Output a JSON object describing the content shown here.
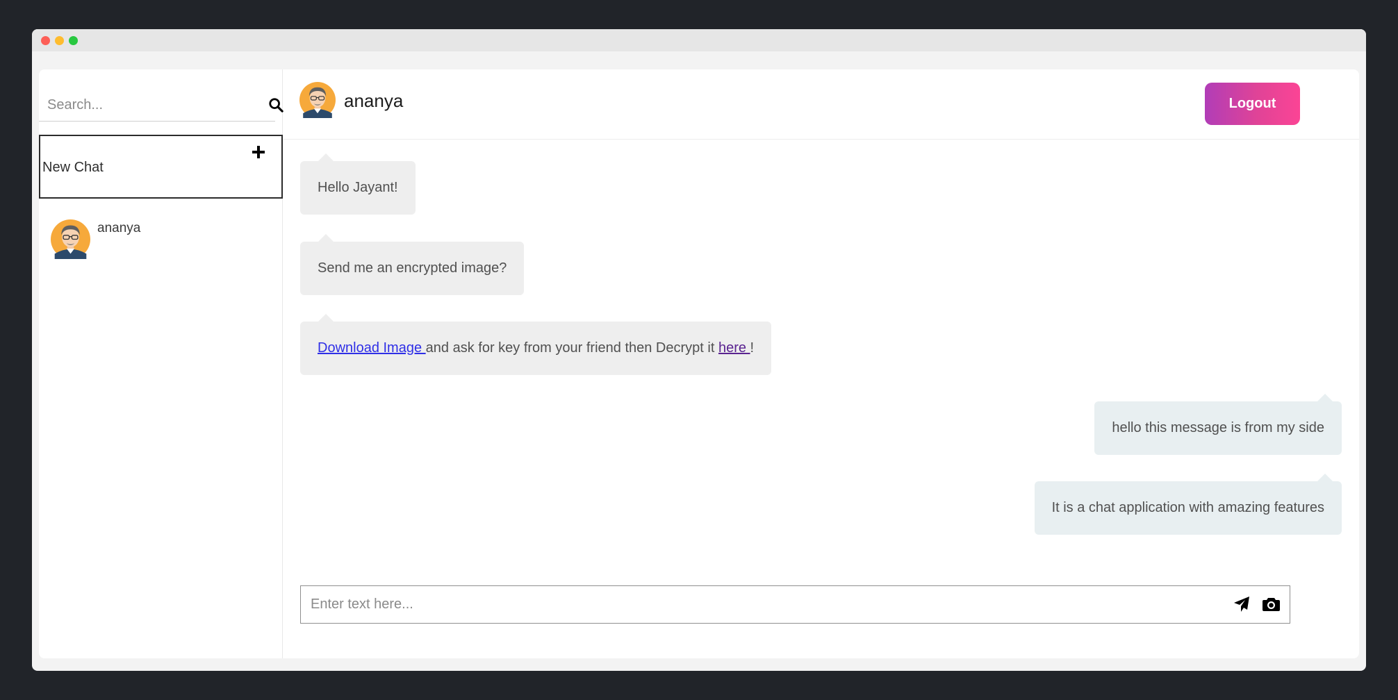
{
  "window": {
    "controls": [
      "close",
      "minimize",
      "zoom"
    ]
  },
  "sidebar": {
    "search": {
      "placeholder": "Search...",
      "value": "",
      "icon": "search-icon"
    },
    "new_chat": {
      "label": "New Chat",
      "icon": "plus-icon"
    },
    "contacts": [
      {
        "name": "ananya",
        "avatar": "avatar-icon"
      }
    ]
  },
  "chat": {
    "header": {
      "name": "ananya",
      "avatar": "avatar-icon",
      "logout_label": "Logout"
    },
    "messages": [
      {
        "direction": "incoming",
        "text": "Hello Jayant!"
      },
      {
        "direction": "incoming",
        "text": "Send me an encrypted image?"
      },
      {
        "direction": "incoming",
        "link1": "Download Image ",
        "middle": "and ask for key from your friend then Decrypt it ",
        "link2": "here ",
        "end": "!"
      },
      {
        "direction": "outgoing",
        "text": "hello this message is from my side"
      },
      {
        "direction": "outgoing",
        "text": "It is a chat application with amazing features"
      }
    ],
    "composer": {
      "placeholder": "Enter text here...",
      "value": "",
      "send_icon": "send-icon",
      "camera_icon": "camera-icon"
    }
  },
  "colors": {
    "background": "#212429",
    "logout_gradient_start": "#b13db7",
    "logout_gradient_end": "#fb4495",
    "incoming_bubble": "#eeeeee",
    "outgoing_bubble": "#e8eff1",
    "link": "#2f2fe6",
    "visited_link": "#5a2390"
  }
}
